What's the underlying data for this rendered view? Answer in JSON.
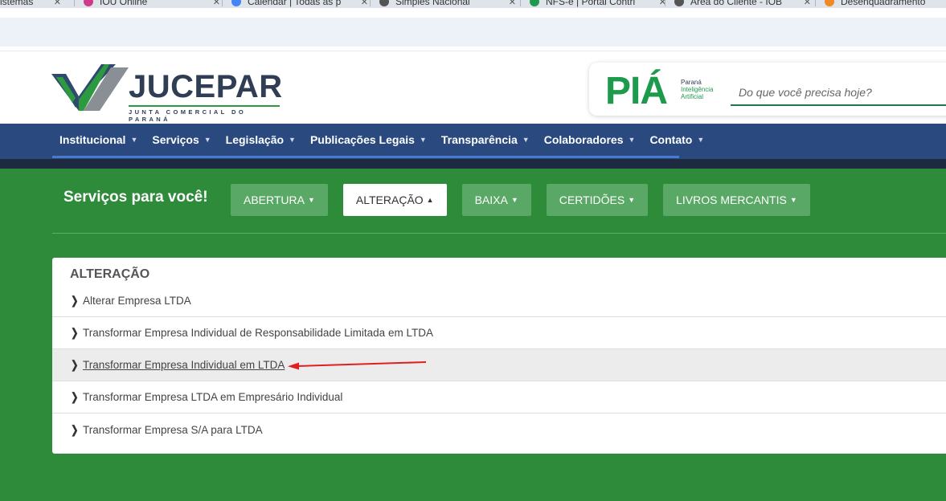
{
  "browser": {
    "tabs": [
      {
        "label": "Sistemas",
        "icon": "bookmark-icon",
        "color": "#3b7ddd"
      },
      {
        "label": "IOU Online",
        "icon": "star-icon",
        "color": "#d03a8a"
      },
      {
        "label": "Calendar | Todas as p",
        "icon": "google-icon",
        "color": "#4285f4"
      },
      {
        "label": "Simples Nacional",
        "icon": "globe-icon",
        "color": "#555555"
      },
      {
        "label": "NFS-e | Portal Contri",
        "icon": "n-icon",
        "color": "#1e9a4c"
      },
      {
        "label": "Área do Cliente - IOB",
        "icon": "globe-icon",
        "color": "#555555"
      },
      {
        "label": "Desenquadramento",
        "icon": "orange-circle-icon",
        "color": "#f08a24"
      }
    ]
  },
  "header": {
    "logo_word": "JUCEPAR",
    "logo_sub": "JUNTA COMERCIAL DO PARANÁ",
    "pia": {
      "word": "PIÁ",
      "state": "Paraná",
      "tag1": "Inteligência",
      "tag2": "Artificial",
      "search_placeholder": "Do que você precisa hoje?"
    }
  },
  "nav": {
    "items": [
      {
        "label": "Institucional"
      },
      {
        "label": "Serviços"
      },
      {
        "label": "Legislação"
      },
      {
        "label": "Publicações Legais"
      },
      {
        "label": "Transparência"
      },
      {
        "label": "Colaboradores"
      },
      {
        "label": "Contato"
      }
    ]
  },
  "services": {
    "title": "Serviços para você!",
    "tabs": [
      {
        "label": "ABERTURA",
        "caret": "▼",
        "active": false
      },
      {
        "label": "ALTERAÇÃO",
        "caret": "▲",
        "active": true
      },
      {
        "label": "BAIXA",
        "caret": "▼",
        "active": false
      },
      {
        "label": "CERTIDÕES",
        "caret": "▼",
        "active": false
      },
      {
        "label": "LIVROS MERCANTIS",
        "caret": "▼",
        "active": false
      }
    ]
  },
  "panel": {
    "title": "ALTERAÇÃO",
    "items": [
      {
        "label": "Alterar Empresa LTDA",
        "highlighted": false
      },
      {
        "label": "Transformar Empresa Individual de Responsabilidade Limitada em LTDA",
        "highlighted": false
      },
      {
        "label": "Transformar Empresa Individual em LTDA",
        "highlighted": true
      },
      {
        "label": "Transformar Empresa LTDA em Empresário Individual",
        "highlighted": false
      },
      {
        "label": "Transformar Empresa S/A para LTDA",
        "highlighted": false
      }
    ]
  },
  "annotation": {
    "color": "#e02020"
  }
}
